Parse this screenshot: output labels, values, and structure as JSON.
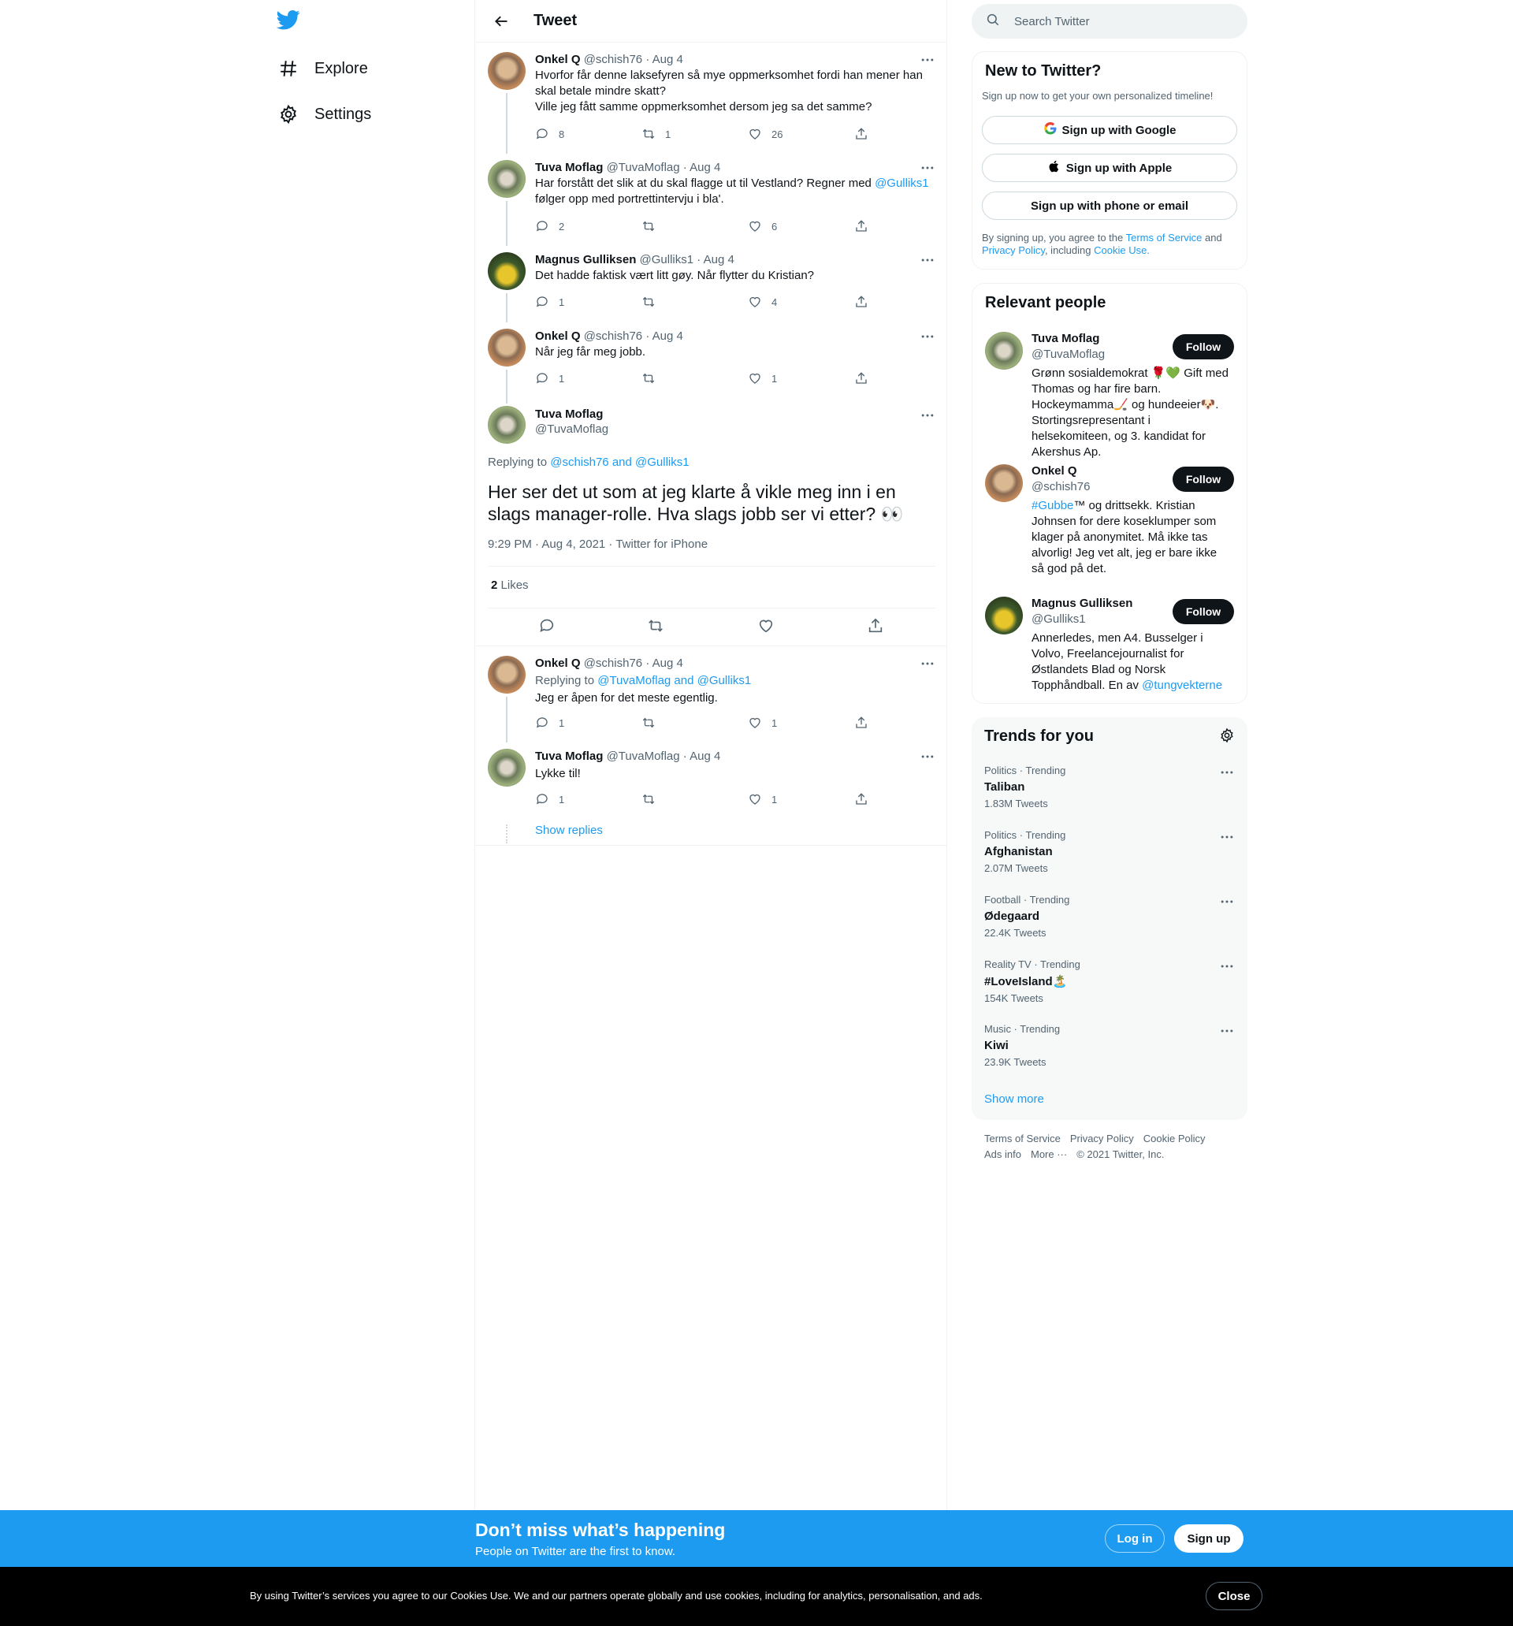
{
  "nav": {
    "logo": "twitter-bird-icon",
    "items": [
      {
        "label": "Explore",
        "icon": "hashtag-icon"
      },
      {
        "label": "Settings",
        "icon": "gear-icon"
      }
    ]
  },
  "header": {
    "title": "Tweet",
    "back_icon": "back-arrow-icon"
  },
  "thread": [
    {
      "name": "Onkel Q",
      "handle": "@schish76",
      "sep": "·",
      "date": "Aug 4",
      "lines": [
        "Hvorfor får denne laksefyren så mye oppmerksomhet fordi han mener han",
        "skal betale mindre skatt?",
        "Ville jeg fått samme oppmerksomhet dersom jeg sa det samme?"
      ],
      "replies": "8",
      "retweets": "1",
      "likes": "26"
    },
    {
      "name": "Tuva Moflag",
      "handle": "@TuvaMoflag",
      "sep": "·",
      "date": "Aug 4",
      "line1_pre": "Har forstått det slik at du skal flagge ut til Vestland? Regner med ",
      "line1_mention": "@Gulliks1",
      "line2": "følger opp med portrettintervju i bla'.",
      "replies": "2",
      "retweets": "",
      "likes": "6"
    },
    {
      "name": "Magnus Gulliksen",
      "handle": "@Gulliks1",
      "sep": "·",
      "date": "Aug 4",
      "text": "Det hadde faktisk vært litt gøy. Når flytter du Kristian?",
      "replies": "1",
      "retweets": "",
      "likes": "4"
    },
    {
      "name": "Onkel Q",
      "handle": "@schish76",
      "sep": "·",
      "date": "Aug 4",
      "text": "Når jeg får meg jobb.",
      "replies": "1",
      "retweets": "",
      "likes": "1"
    }
  ],
  "focus": {
    "name": "Tuva Moflag",
    "handle": "@TuvaMoflag",
    "replying_label": "Replying to",
    "replying_to": "@schish76 and @Gulliks1",
    "text": "Her ser det ut som at jeg klarte å vikle meg inn i en slags manager-rolle. Hva slags jobb ser vi etter? 👀",
    "timestamp": "9:29 PM · Aug 4, 2021 · Twitter for iPhone",
    "likes_count": "2",
    "likes_label": "Likes"
  },
  "replies": [
    {
      "name": "Onkel Q",
      "handle": "@schish76",
      "sep": "·",
      "date": "Aug 4",
      "replying_label": "Replying to",
      "replying_to": "@TuvaMoflag and @Gulliks1",
      "text": "Jeg er åpen for det meste egentlig.",
      "replies": "1",
      "retweets": "",
      "likes": "1"
    },
    {
      "name": "Tuva Moflag",
      "handle": "@TuvaMoflag",
      "sep": "·",
      "date": "Aug 4",
      "text": "Lykke til!",
      "replies": "1",
      "retweets": "",
      "likes": "1"
    }
  ],
  "show_replies": "Show replies",
  "search": {
    "placeholder": "Search Twitter"
  },
  "new_to_twitter": {
    "title": "New to Twitter?",
    "subtitle": "Sign up now to get your own personalized timeline!",
    "google": "Sign up with Google",
    "apple": "Sign up with Apple",
    "phone": "Sign up with phone or email",
    "legal_1": "By signing up, you agree to the ",
    "terms": "Terms of Service",
    "legal_and": " and",
    "privacy": "Privacy Policy",
    "legal_2": ", including ",
    "cookie": "Cookie Use."
  },
  "relevant": {
    "title": "Relevant people",
    "follow_label": "Follow",
    "people": [
      {
        "name": "Tuva Moflag",
        "handle": "@TuvaMoflag",
        "bio": "Grønn sosialdemokrat 🌹💚 Gift med Thomas og har fire barn. Hockeymamma🏒 og hundeeier🐶. Stortingsrepresentant i helsekomiteen, og 3. kandidat for Akershus Ap."
      },
      {
        "name": "Onkel Q",
        "handle": "@schish76",
        "bio_mention": "#Gubbe",
        "bio": "™ og drittsekk. Kristian Johnsen for dere koseklumper som klager på anonymitet. Må ikke tas alvorlig! Jeg vet alt, jeg er bare ikke så god på det."
      },
      {
        "name": "Magnus Gulliksen",
        "handle": "@Gulliks1",
        "bio": "Annerledes, men A4. Busselger i Volvo, Freelancejournalist for Østlandets Blad og Norsk Topphåndball. En av ",
        "bio_mention": "@tungvekterne"
      }
    ]
  },
  "trends": {
    "title": "Trends for you",
    "items": [
      {
        "category": "Politics · Trending",
        "name": "Taliban",
        "count": "1.83M Tweets"
      },
      {
        "category": "Politics · Trending",
        "name": "Afghanistan",
        "count": "2.07M Tweets"
      },
      {
        "category": "Football · Trending",
        "name": "Ødegaard",
        "count": "22.4K Tweets"
      },
      {
        "category": "Reality TV · Trending",
        "name": "#LoveIsland🏝️",
        "count": "154K Tweets"
      },
      {
        "category": "Music · Trending",
        "name": "Kiwi",
        "count": "23.9K Tweets"
      }
    ],
    "show_more": "Show more"
  },
  "footer": {
    "row1": [
      "Terms of Service",
      "Privacy Policy",
      "Cookie Policy"
    ],
    "row2": [
      "Ads info",
      "More ···",
      "© 2021 Twitter, Inc."
    ]
  },
  "signup_bar": {
    "title": "Don’t miss what’s happening",
    "subtitle": "People on Twitter are the first to know.",
    "login": "Log in",
    "signup": "Sign up"
  },
  "cookie_bar": {
    "text": "By using Twitter’s services you agree to our Cookies Use. We and our partners operate globally and use cookies, including for analytics, personalisation, and ads.",
    "close": "Close"
  },
  "colors": {
    "accent": "#1d9bf0",
    "text": "#0f1419",
    "muted": "#536471",
    "border": "#eff3f4"
  }
}
